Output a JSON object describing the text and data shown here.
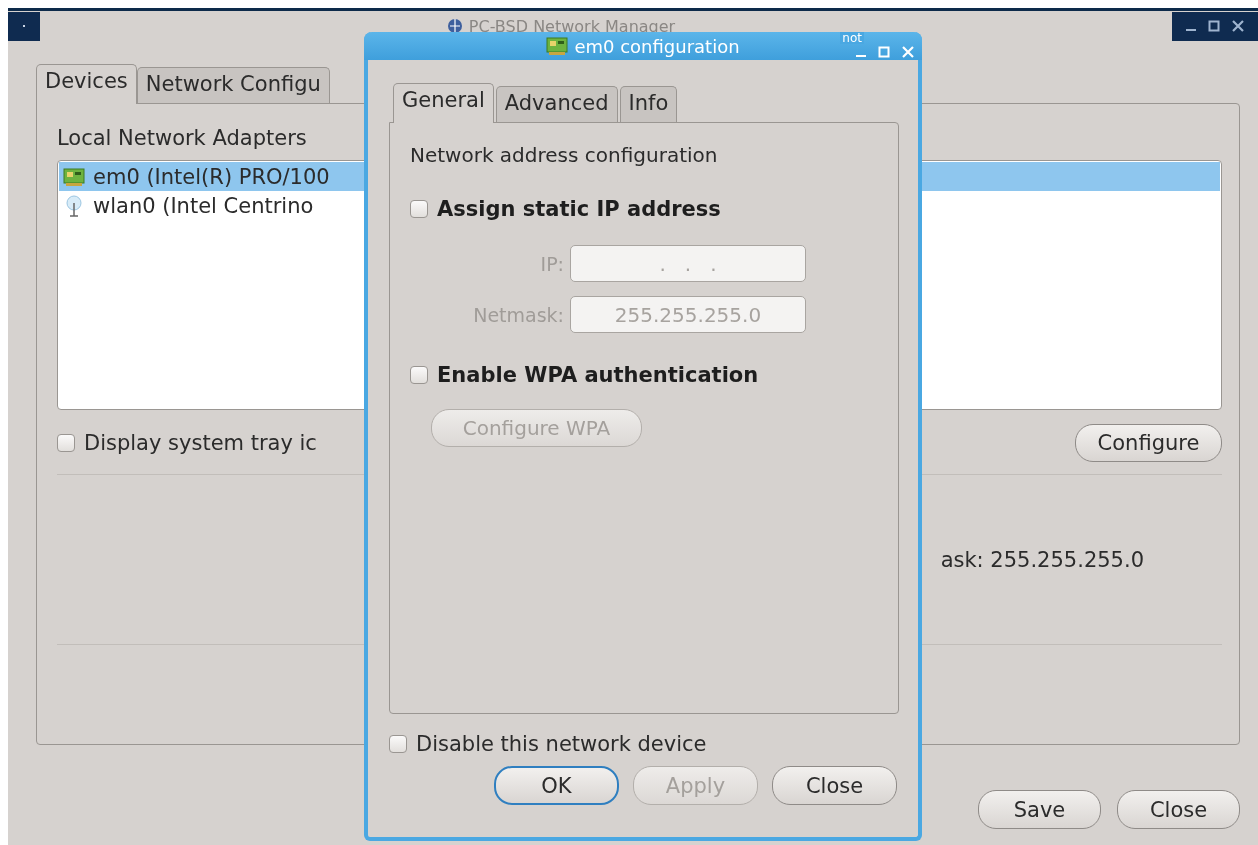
{
  "main_window": {
    "title": "PC-BSD Network Manager",
    "tabs": [
      {
        "label": "Devices",
        "selected": true
      },
      {
        "label": "Network Configu",
        "selected": false
      }
    ],
    "adapters_label": "Local Network Adapters",
    "adapters": [
      {
        "label": "em0 (Intel(R) PRO/100",
        "kind": "wired",
        "selected": true
      },
      {
        "label": "wlan0 (Intel Centrino",
        "kind": "wireless",
        "selected": false
      }
    ],
    "tray_checkbox": {
      "label": "Display system tray ic",
      "checked": false
    },
    "configure_button": {
      "label": "Configure"
    },
    "netmask_text": "ask: 255.255.255.0",
    "buttons": [
      {
        "label": "Save"
      },
      {
        "label": "Close"
      }
    ]
  },
  "dialog": {
    "title": "em0 configuration",
    "title_fragment": "not",
    "tabs": [
      {
        "label": "General",
        "selected": true
      },
      {
        "label": "Advanced",
        "selected": false
      },
      {
        "label": "Info",
        "selected": false
      }
    ],
    "section_label": "Network address configuration",
    "static_ip": {
      "label": "Assign static IP address",
      "checked": false
    },
    "fields": [
      {
        "label": "IP:",
        "value": ".   .   .",
        "disabled": true
      },
      {
        "label": "Netmask:",
        "value": "255.255.255.0",
        "disabled": true
      }
    ],
    "wpa": {
      "label": "Enable WPA authentication",
      "checked": false
    },
    "wpa_button": {
      "label": "Configure WPA",
      "disabled": true
    },
    "disable_checkbox": {
      "label": "Disable this network device",
      "checked": false
    },
    "buttons": [
      {
        "label": "OK",
        "disabled": false,
        "focused": true
      },
      {
        "label": "Apply",
        "disabled": true,
        "focused": false
      },
      {
        "label": "Close",
        "disabled": false,
        "focused": false
      }
    ]
  }
}
